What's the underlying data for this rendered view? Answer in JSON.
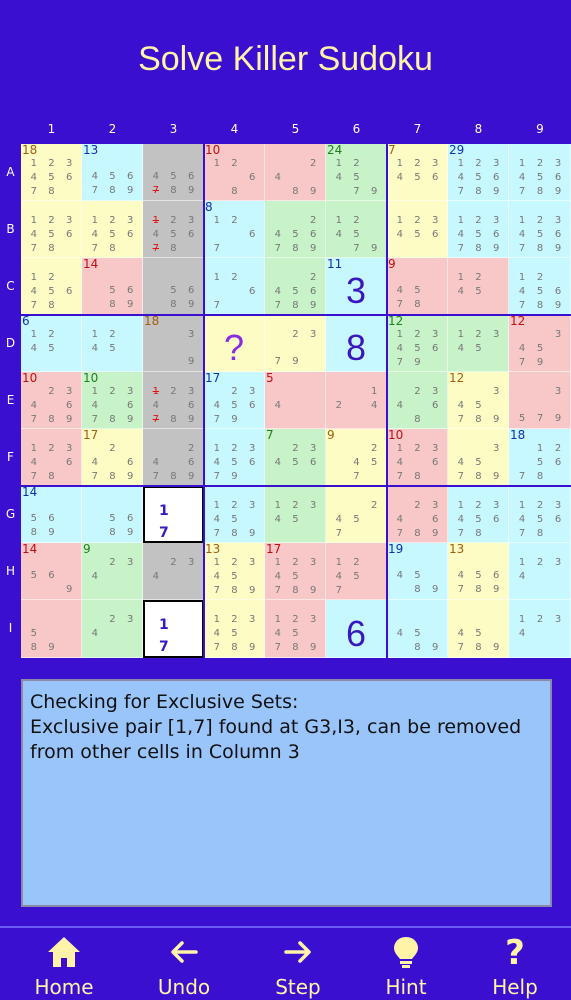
{
  "app": {
    "title": "Solve Killer Sudoku"
  },
  "columns": [
    "1",
    "2",
    "3",
    "4",
    "5",
    "6",
    "7",
    "8",
    "9"
  ],
  "rows": [
    "A",
    "B",
    "C",
    "D",
    "E",
    "F",
    "G",
    "H",
    "I"
  ],
  "colors": {
    "pink": "#f8c8c8",
    "cyan": "#c8f8ff",
    "yellow": "#fcfcc4",
    "green": "#c8f2c8",
    "gray": "#c2c2c2",
    "white": "#ffffff",
    "cageText": {
      "brown": "#a06010",
      "blue": "#1030b0",
      "red": "#c01010",
      "green": "#208020",
      "purple": "#8030a0"
    }
  },
  "cells": [
    [
      {
        "bg": "yellow",
        "cage": "18",
        "cageColor": "brown",
        "c": [
          "1",
          "2",
          "3",
          "4",
          "5",
          "6",
          "7",
          "8",
          ""
        ]
      },
      {
        "bg": "cyan",
        "cage": "13",
        "cageColor": "blue",
        "c": [
          "",
          "",
          "",
          "4",
          "5",
          "6",
          "7",
          "8",
          "9"
        ]
      },
      {
        "bg": "gray",
        "c": [
          "",
          "",
          "",
          "4",
          "5",
          "6",
          "7x",
          "8",
          "9"
        ]
      },
      {
        "bg": "pink",
        "cage": "10",
        "cageColor": "red",
        "c": [
          "1",
          "2",
          "",
          "",
          "",
          "6",
          "",
          "8",
          ""
        ]
      },
      {
        "bg": "pink",
        "c": [
          "",
          "",
          "2",
          "4",
          "",
          "",
          "",
          "8",
          "9"
        ]
      },
      {
        "bg": "green",
        "cage": "24",
        "cageColor": "green",
        "c": [
          "1",
          "2",
          "",
          "4",
          "5",
          "",
          "",
          "7",
          "9"
        ]
      },
      {
        "bg": "yellow",
        "cage": "7",
        "cageColor": "brown",
        "c": [
          "1",
          "2",
          "3",
          "4",
          "5",
          "6",
          "",
          "",
          ""
        ]
      },
      {
        "bg": "cyan",
        "cage": "29",
        "cageColor": "blue",
        "c": [
          "1",
          "2",
          "3",
          "4",
          "5",
          "6",
          "7",
          "8",
          "9"
        ]
      },
      {
        "bg": "cyan",
        "c": [
          "1",
          "2",
          "3",
          "4",
          "5",
          "6",
          "7",
          "8",
          "9"
        ]
      }
    ],
    [
      {
        "bg": "yellow",
        "c": [
          "1",
          "2",
          "3",
          "4",
          "5",
          "6",
          "7",
          "8",
          ""
        ]
      },
      {
        "bg": "yellow",
        "c": [
          "1",
          "2",
          "3",
          "4",
          "5",
          "6",
          "7",
          "8",
          ""
        ]
      },
      {
        "bg": "gray",
        "c": [
          "1x",
          "2",
          "3",
          "4",
          "5",
          "6",
          "7x",
          "8",
          ""
        ]
      },
      {
        "bg": "cyan",
        "cage": "8",
        "cageColor": "blue",
        "c": [
          "1",
          "2",
          "",
          "",
          "",
          "6",
          "7",
          "",
          ""
        ]
      },
      {
        "bg": "green",
        "c": [
          "",
          "",
          "2",
          "4",
          "5",
          "6",
          "7",
          "8",
          "9"
        ]
      },
      {
        "bg": "green",
        "c": [
          "1",
          "2",
          "",
          "4",
          "5",
          "",
          "",
          "7",
          "9"
        ]
      },
      {
        "bg": "yellow",
        "c": [
          "1",
          "2",
          "3",
          "4",
          "5",
          "6",
          "",
          "",
          ""
        ]
      },
      {
        "bg": "cyan",
        "c": [
          "1",
          "2",
          "3",
          "4",
          "5",
          "6",
          "7",
          "8",
          "9"
        ]
      },
      {
        "bg": "cyan",
        "c": [
          "1",
          "2",
          "3",
          "4",
          "5",
          "6",
          "7",
          "8",
          "9"
        ]
      }
    ],
    [
      {
        "bg": "yellow",
        "c": [
          "1",
          "2",
          "",
          "4",
          "5",
          "6",
          "7",
          "8",
          ""
        ]
      },
      {
        "bg": "pink",
        "cage": "14",
        "cageColor": "red",
        "c": [
          "",
          "",
          "",
          "",
          "5",
          "6",
          "",
          "8",
          "9"
        ]
      },
      {
        "bg": "gray",
        "c": [
          "",
          "",
          "",
          "",
          "5",
          "6",
          "",
          "8",
          "9"
        ]
      },
      {
        "bg": "cyan",
        "c": [
          "1",
          "2",
          "",
          "",
          "",
          "6",
          "7",
          "",
          ""
        ]
      },
      {
        "bg": "green",
        "c": [
          "",
          "",
          "2",
          "4",
          "5",
          "6",
          "7",
          "8",
          "9"
        ]
      },
      {
        "bg": "cyan",
        "cage": "11",
        "cageColor": "blue",
        "v": "3"
      },
      {
        "bg": "pink",
        "cage": "9",
        "cageColor": "red",
        "c": [
          "",
          "",
          "",
          "4",
          "5",
          "",
          "7",
          "8",
          ""
        ]
      },
      {
        "bg": "pink",
        "c": [
          "1",
          "2",
          "",
          "4",
          "5",
          "",
          "",
          "",
          ""
        ]
      },
      {
        "bg": "cyan",
        "c": [
          "1",
          "2",
          "",
          "4",
          "5",
          "6",
          "7",
          "8",
          "9"
        ]
      }
    ],
    [
      {
        "bg": "cyan",
        "cage": "6",
        "cageColor": "blue",
        "c": [
          "1",
          "2",
          "",
          "4",
          "5",
          "",
          "",
          "",
          ""
        ]
      },
      {
        "bg": "cyan",
        "c": [
          "1",
          "2",
          "",
          "4",
          "5",
          "",
          "",
          "",
          ""
        ]
      },
      {
        "bg": "gray",
        "cage": "18",
        "cageColor": "brown",
        "c": [
          "",
          "",
          "3",
          "",
          "",
          "",
          "",
          "",
          "9"
        ]
      },
      {
        "bg": "yellow",
        "q": "?"
      },
      {
        "bg": "yellow",
        "c": [
          "",
          "2",
          "3",
          "",
          "",
          "",
          "7",
          "9",
          ""
        ]
      },
      {
        "bg": "cyan",
        "v": "8"
      },
      {
        "bg": "green",
        "cage": "12",
        "cageColor": "green",
        "c": [
          "1",
          "2",
          "3",
          "4",
          "5",
          "6",
          "7",
          "9",
          ""
        ]
      },
      {
        "bg": "green",
        "c": [
          "1",
          "2",
          "3",
          "4",
          "5",
          "",
          "",
          "",
          ""
        ]
      },
      {
        "bg": "pink",
        "cage": "12",
        "cageColor": "red",
        "c": [
          "",
          "",
          "3",
          "4",
          "5",
          "",
          "7",
          "9",
          ""
        ]
      }
    ],
    [
      {
        "bg": "pink",
        "cage": "10",
        "cageColor": "red",
        "c": [
          "",
          "2",
          "3",
          "4",
          "",
          "6",
          "7",
          "8",
          "9"
        ]
      },
      {
        "bg": "green",
        "cage": "10",
        "cageColor": "green",
        "c": [
          "1",
          "2",
          "3",
          "4",
          "",
          "6",
          "7",
          "8",
          "9"
        ]
      },
      {
        "bg": "gray",
        "c": [
          "1x",
          "2",
          "3",
          "4",
          "",
          "6",
          "7x",
          "8",
          "9"
        ]
      },
      {
        "bg": "cyan",
        "cage": "17",
        "cageColor": "blue",
        "c": [
          "",
          "2",
          "3",
          "4",
          "5",
          "6",
          "7",
          "9",
          ""
        ]
      },
      {
        "bg": "pink",
        "cage": "5",
        "cageColor": "red",
        "c": [
          "",
          "",
          "",
          "4",
          "",
          "",
          "",
          "",
          ""
        ]
      },
      {
        "bg": "pink",
        "c": [
          "",
          "",
          "1",
          "2",
          "",
          "4",
          "",
          "",
          ""
        ]
      },
      {
        "bg": "green",
        "c": [
          "",
          "2",
          "3",
          "4",
          "",
          "6",
          "",
          "8",
          ""
        ]
      },
      {
        "bg": "yellow",
        "cage": "12",
        "cageColor": "brown",
        "c": [
          "",
          "",
          "3",
          "4",
          "5",
          "",
          "7",
          "8",
          "9"
        ]
      },
      {
        "bg": "pink",
        "c": [
          "",
          "",
          "3",
          "",
          "",
          "",
          "5",
          "7",
          "9"
        ]
      }
    ],
    [
      {
        "bg": "pink",
        "c": [
          "1",
          "2",
          "3",
          "4",
          "",
          "6",
          "7",
          "8",
          ""
        ]
      },
      {
        "bg": "yellow",
        "cage": "17",
        "cageColor": "brown",
        "c": [
          "",
          "2",
          "",
          "4",
          "",
          "6",
          "7",
          "8",
          "9"
        ]
      },
      {
        "bg": "gray",
        "c": [
          "",
          "",
          "2",
          "4",
          "",
          "6",
          "7",
          "8",
          "9"
        ]
      },
      {
        "bg": "cyan",
        "c": [
          "1",
          "2",
          "3",
          "4",
          "5",
          "6",
          "7",
          "9",
          ""
        ]
      },
      {
        "bg": "green",
        "cage": "7",
        "cageColor": "green",
        "c": [
          "",
          "2",
          "3",
          "4",
          "5",
          "6",
          "",
          "",
          ""
        ]
      },
      {
        "bg": "yellow",
        "cage": "9",
        "cageColor": "brown",
        "c": [
          "",
          "",
          "2",
          "",
          "4",
          "5",
          "",
          "7",
          ""
        ]
      },
      {
        "bg": "pink",
        "cage": "10",
        "cageColor": "red",
        "c": [
          "1",
          "2",
          "3",
          "4",
          "",
          "6",
          "7",
          "8",
          ""
        ]
      },
      {
        "bg": "yellow",
        "c": [
          "",
          "",
          "3",
          "4",
          "5",
          "",
          "7",
          "8",
          "9"
        ]
      },
      {
        "bg": "cyan",
        "cage": "18",
        "cageColor": "blue",
        "c": [
          "",
          "1",
          "2",
          "",
          "5",
          "6",
          "7",
          "8",
          ""
        ]
      }
    ],
    [
      {
        "bg": "cyan",
        "cage": "14",
        "cageColor": "blue",
        "c": [
          "",
          "",
          "",
          "5",
          "6",
          "",
          "8",
          "9",
          ""
        ]
      },
      {
        "bg": "cyan",
        "c": [
          "",
          "",
          "",
          "",
          "5",
          "6",
          "",
          "8",
          "9"
        ]
      },
      {
        "bg": "white",
        "sel": true,
        "pair": [
          "1",
          "7"
        ]
      },
      {
        "bg": "cyan",
        "c": [
          "1",
          "2",
          "3",
          "4",
          "5",
          "",
          "7",
          "8",
          "9"
        ]
      },
      {
        "bg": "green",
        "c": [
          "1",
          "2",
          "3",
          "4",
          "5",
          "",
          "",
          "",
          ""
        ]
      },
      {
        "bg": "yellow",
        "c": [
          "",
          "",
          "2",
          "4",
          "5",
          "",
          "7",
          "",
          ""
        ]
      },
      {
        "bg": "pink",
        "c": [
          "",
          "2",
          "3",
          "4",
          "",
          "6",
          "7",
          "8",
          "9"
        ]
      },
      {
        "bg": "cyan",
        "c": [
          "1",
          "2",
          "3",
          "4",
          "5",
          "6",
          "7",
          "8",
          ""
        ]
      },
      {
        "bg": "cyan",
        "c": [
          "1",
          "2",
          "3",
          "4",
          "5",
          "6",
          "7",
          "8",
          ""
        ]
      }
    ],
    [
      {
        "bg": "pink",
        "cage": "14",
        "cageColor": "red",
        "c": [
          "",
          "",
          "",
          "5",
          "6",
          "",
          "",
          "",
          "9"
        ]
      },
      {
        "bg": "green",
        "cage": "9",
        "cageColor": "green",
        "c": [
          "",
          "2",
          "3",
          "4",
          "",
          "",
          "",
          "",
          ""
        ]
      },
      {
        "bg": "gray",
        "c": [
          "",
          "2",
          "3",
          "4",
          "",
          "",
          "",
          "",
          ""
        ]
      },
      {
        "bg": "yellow",
        "cage": "13",
        "cageColor": "brown",
        "c": [
          "1",
          "2",
          "3",
          "4",
          "5",
          "",
          "7",
          "8",
          "9"
        ]
      },
      {
        "bg": "pink",
        "cage": "17",
        "cageColor": "red",
        "c": [
          "1",
          "2",
          "3",
          "4",
          "5",
          "",
          "7",
          "8",
          "9"
        ]
      },
      {
        "bg": "pink",
        "c": [
          "1",
          "2",
          "",
          "4",
          "5",
          "",
          "7",
          "",
          ""
        ]
      },
      {
        "bg": "cyan",
        "cage": "19",
        "cageColor": "blue",
        "c": [
          "",
          "",
          "",
          "4",
          "5",
          "",
          "",
          "8",
          "9"
        ]
      },
      {
        "bg": "yellow",
        "cage": "13",
        "cageColor": "brown",
        "c": [
          "",
          "",
          "",
          "4",
          "5",
          "6",
          "7",
          "8",
          "9"
        ]
      },
      {
        "bg": "cyan",
        "c": [
          "1",
          "2",
          "3",
          "4",
          "",
          "",
          "",
          "",
          ""
        ]
      }
    ],
    [
      {
        "bg": "pink",
        "c": [
          "",
          "",
          "",
          "5",
          "",
          "",
          "8",
          "9",
          ""
        ]
      },
      {
        "bg": "green",
        "c": [
          "",
          "2",
          "3",
          "4",
          "",
          "",
          "",
          "",
          ""
        ]
      },
      {
        "bg": "white",
        "sel": true,
        "pair": [
          "1",
          "7"
        ]
      },
      {
        "bg": "yellow",
        "c": [
          "1",
          "2",
          "3",
          "4",
          "5",
          "",
          "7",
          "8",
          "9"
        ]
      },
      {
        "bg": "pink",
        "c": [
          "1",
          "2",
          "3",
          "4",
          "5",
          "",
          "7",
          "8",
          "9"
        ]
      },
      {
        "bg": "cyan",
        "v": "6"
      },
      {
        "bg": "cyan",
        "c": [
          "",
          "",
          "",
          "4",
          "5",
          "",
          "",
          "8",
          "9"
        ]
      },
      {
        "bg": "yellow",
        "c": [
          "",
          "",
          "",
          "4",
          "5",
          "",
          "7",
          "8",
          "9"
        ]
      },
      {
        "bg": "cyan",
        "c": [
          "1",
          "2",
          "3",
          "4",
          "",
          "",
          "",
          "",
          ""
        ]
      }
    ]
  ],
  "message": {
    "lines": [
      "Checking for Exclusive Sets:",
      "Exclusive pair [1,7] found at G3,I3, can be removed",
      "from other cells in Column 3"
    ]
  },
  "nav": [
    {
      "label": "Home",
      "icon": "home-icon"
    },
    {
      "label": "Undo",
      "icon": "arrow-left-icon"
    },
    {
      "label": "Step",
      "icon": "arrow-right-icon"
    },
    {
      "label": "Hint",
      "icon": "lightbulb-icon"
    },
    {
      "label": "Help",
      "icon": "help-icon"
    }
  ]
}
